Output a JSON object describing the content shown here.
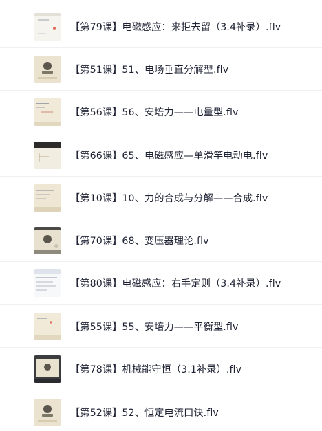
{
  "files": [
    {
      "name": "【第79课】电磁感应：来拒去留（3.4补录）.flv",
      "thumb_icon": "video-thumbnail-whiteboard-icon"
    },
    {
      "name": "【第51课】51、电场垂直分解型.flv",
      "thumb_icon": "video-thumbnail-title-card-icon"
    },
    {
      "name": "【第56课】56、安培力——电量型.flv",
      "thumb_icon": "video-thumbnail-notes-icon"
    },
    {
      "name": "【第66课】65、电磁感应—单滑竿电动电.flv",
      "thumb_icon": "video-thumbnail-dark-header-icon"
    },
    {
      "name": "【第10课】10、力的合成与分解——合成.flv",
      "thumb_icon": "video-thumbnail-notes-icon"
    },
    {
      "name": "【第70课】68、变压器理论.flv",
      "thumb_icon": "video-thumbnail-player-icon"
    },
    {
      "name": "【第80课】电磁感应：右手定则（3.4补录）.flv",
      "thumb_icon": "video-thumbnail-document-icon"
    },
    {
      "name": "【第55课】55、安培力——平衡型.flv",
      "thumb_icon": "video-thumbnail-notes-icon"
    },
    {
      "name": "【第78课】机械能守恒（3.1补录）.flv",
      "thumb_icon": "video-thumbnail-player-icon"
    },
    {
      "name": "【第52课】52、恒定电流口诀.flv",
      "thumb_icon": "video-thumbnail-title-card-icon"
    }
  ],
  "colors": {
    "text": "#1e2233",
    "divider": "#eef0f3",
    "thumb_paper": "#ece5d3",
    "thumb_emblem": "#5a564d"
  }
}
